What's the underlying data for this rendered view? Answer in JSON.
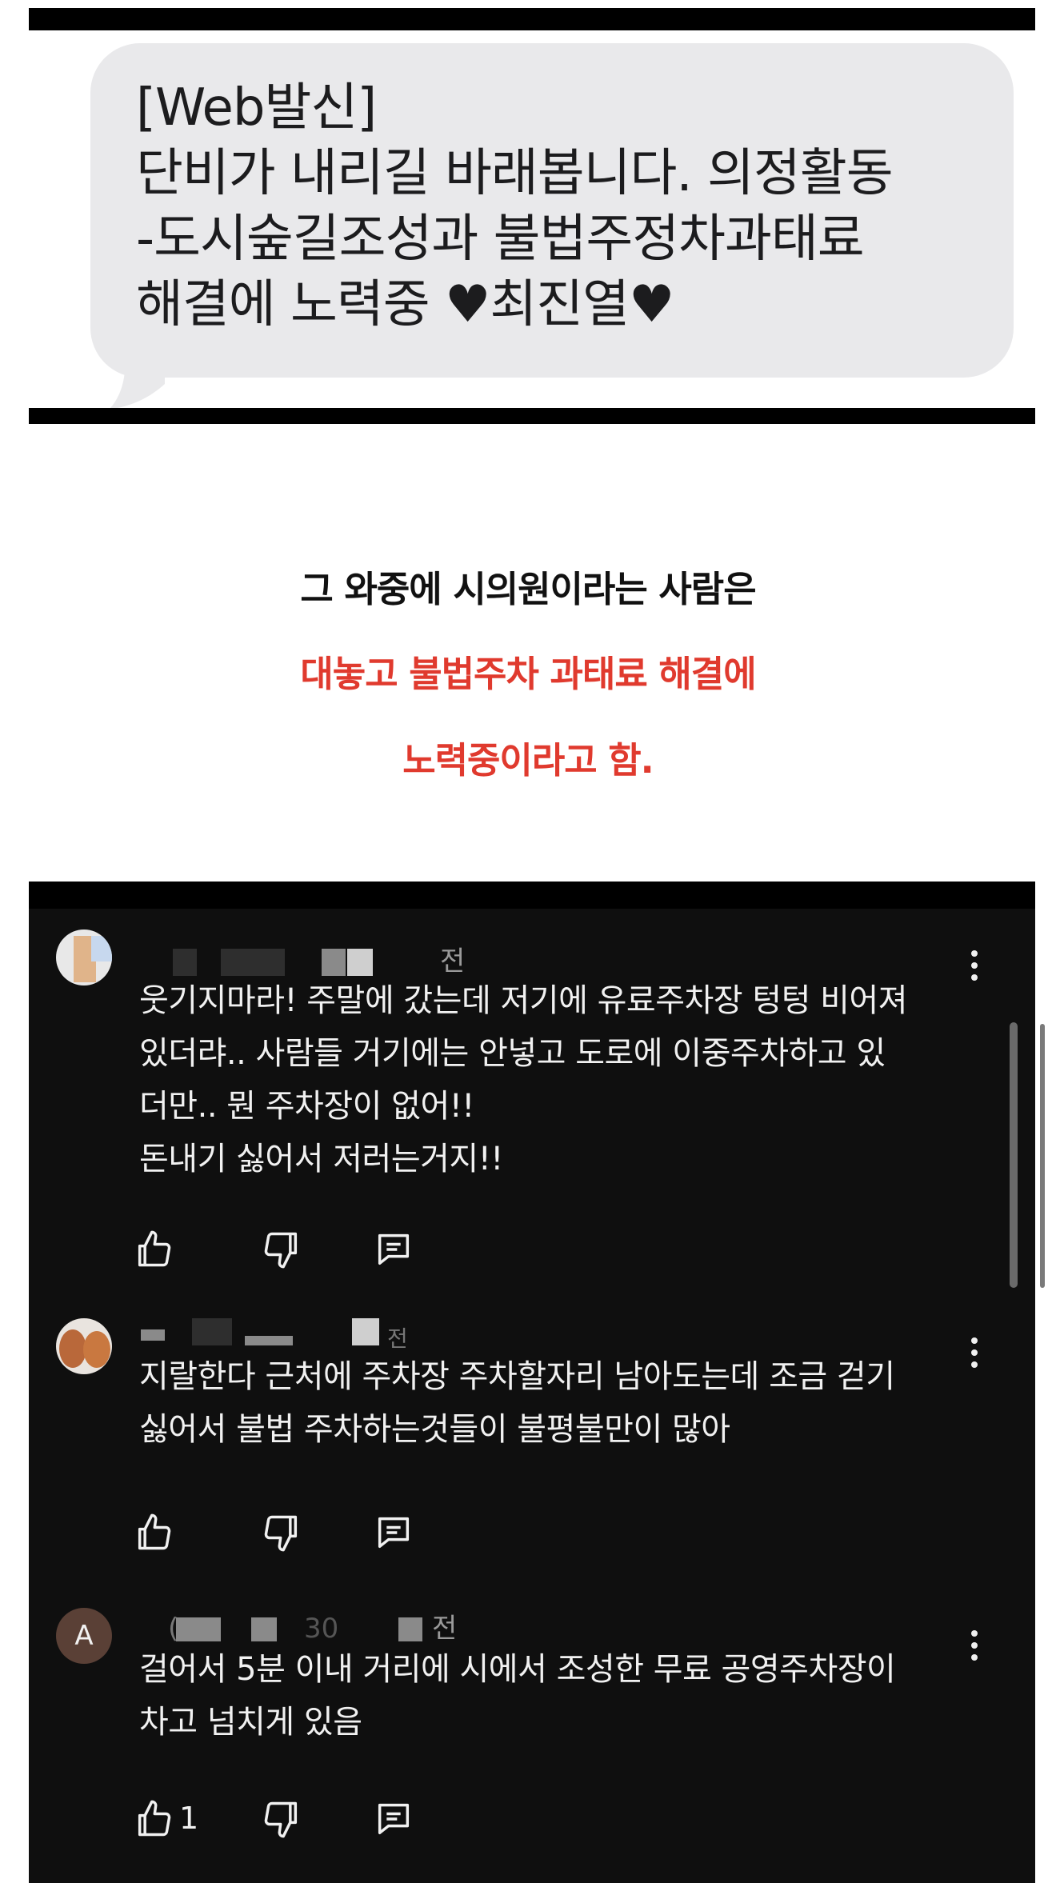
{
  "sms": {
    "message": "[Web발신]\n단비가 내리길 바래봅니다. 의정활동\n-도시숲길조성과 불법주정차과태료\n해결에 노력중 ♥최진열♥",
    "bubble_color": "#e9e9eb"
  },
  "caption": {
    "line1": "그 와중에 시의원이라는 사람은",
    "line2": "대놓고 불법주차 과태료 해결에",
    "line3": "노력중이라고 함.",
    "highlight_color": "#e03a2e"
  },
  "comments": [
    {
      "time_ago": "전",
      "text": "웃기지마라! 주말에 갔는데 저기에 유료주차장 텅텅 비어져\n있더랴.. 사람들 거기에는 안넣고 도로에 이중주차하고 있\n더만.. 뭔 주차장이 없어!!\n돈내기 싫어서 저러는거지!!",
      "like_count": "",
      "avatar_icon": "pixelated-avatar-icon"
    },
    {
      "time_ago": "전",
      "text": "지랄한다 근처에 주차장 주차할자리 남아도는데 조금 걷기\n싫어서 불법 주차하는것들이 불평불만이 많아",
      "like_count": "",
      "avatar_icon": "food-avatar-icon"
    },
    {
      "avatar_letter": "A",
      "handle_partial": "(",
      "date_partial": "30",
      "time_ago": "전",
      "text": "걸어서 5분 이내 거리에 시에서 조성한 무료 공영주차장이\n차고 넘치게 있음",
      "like_count": "1",
      "avatar_icon": "letter-avatar"
    }
  ],
  "icons": {
    "like": "thumbs-up-icon",
    "dislike": "thumbs-down-icon",
    "reply": "reply-icon",
    "more": "more-vertical-icon"
  },
  "colors": {
    "dark_bg": "#0f0f0f",
    "comment_text": "#f1f1f1",
    "meta_text": "#9a9a9a"
  }
}
